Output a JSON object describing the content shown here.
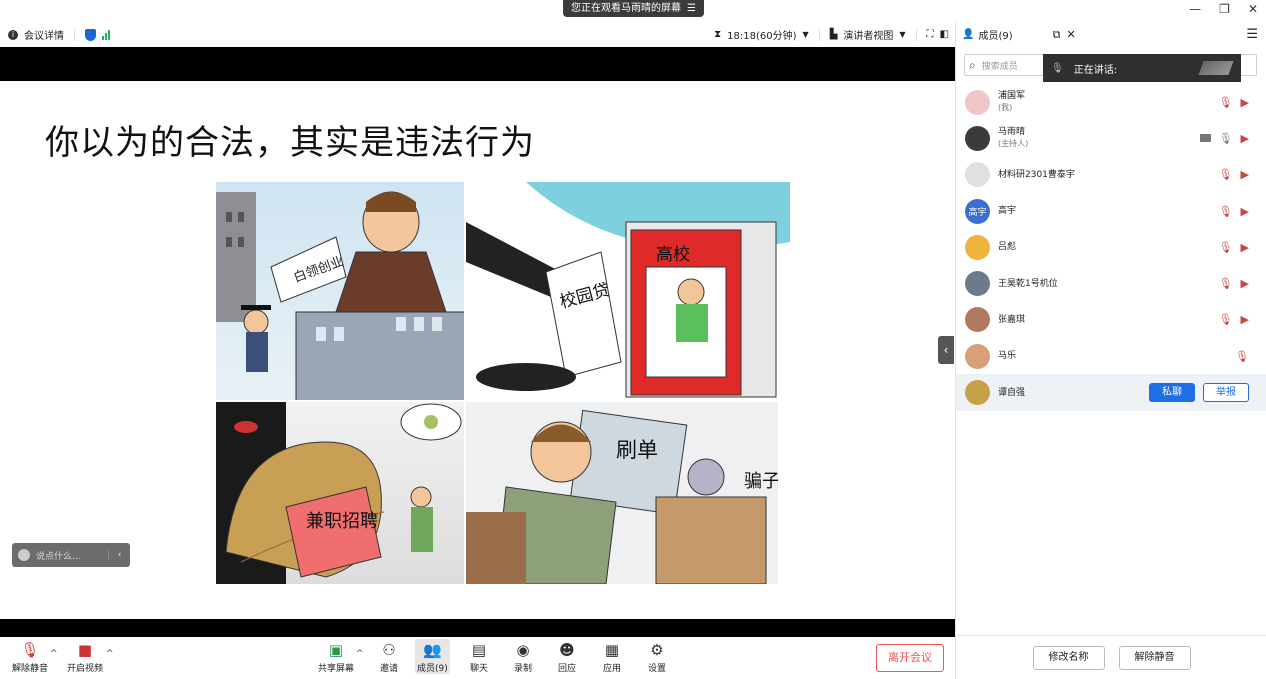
{
  "titlebar": {
    "banner": "您正在观看马雨晴的屏幕",
    "banner_icon": "menu-lines-icon",
    "min": "—",
    "restore": "❐",
    "close": "✕"
  },
  "infobar": {
    "meeting_details": "会议详情",
    "timer": "18:18(60分钟)",
    "view_mode": "演讲者视图"
  },
  "slide": {
    "title": "你以为的合法，其实是违法行为",
    "panel_texts": {
      "p1_sign": "白领创业",
      "p2_door": "高校",
      "p2_bag": "校园贷",
      "p3_label": "兼职招聘",
      "p4_screen": "刷单",
      "p4_side": "骗子"
    }
  },
  "chat": {
    "placeholder": "说点什么..."
  },
  "toolbar": {
    "unmute": "解除静音",
    "start_video": "开启视频",
    "share_screen": "共享屏幕",
    "invite": "邀请",
    "members": "成员(9)",
    "chat": "聊天",
    "record": "录制",
    "react": "回应",
    "apps": "应用",
    "settings": "设置",
    "leave": "离开会议"
  },
  "sidebar": {
    "title": "成员(9)",
    "search_placeholder": "搜索成员",
    "speaking_label": "正在讲话:",
    "members": [
      {
        "name": "浦国军",
        "sub": "(我)",
        "avatar_text": "",
        "avatar_color": "#f1c6c6"
      },
      {
        "name": "马雨晴",
        "sub": "(主持人)",
        "avatar_text": "",
        "avatar_color": "#3b3b3b"
      },
      {
        "name": "材料研2301曹泰宇",
        "sub": "",
        "avatar_text": "",
        "avatar_color": "#e0e0e0"
      },
      {
        "name": "高宇",
        "sub": "",
        "avatar_text": "高宇",
        "avatar_color": "#3a6fd0"
      },
      {
        "name": "吕彪",
        "sub": "",
        "avatar_text": "",
        "avatar_color": "#f0b43c"
      },
      {
        "name": "王昊乾1号机位",
        "sub": "",
        "avatar_text": "",
        "avatar_color": "#6b7b8c"
      },
      {
        "name": "张嘉琪",
        "sub": "",
        "avatar_text": "",
        "avatar_color": "#b07a60"
      },
      {
        "name": "马乐",
        "sub": "",
        "avatar_text": "",
        "avatar_color": "#d8a07a"
      },
      {
        "name": "谭自强",
        "sub": "",
        "avatar_text": "",
        "avatar_color": "#c8a048"
      }
    ],
    "private_chat": "私聊",
    "report": "举报",
    "rename": "修改名称",
    "unmute": "解除静音"
  }
}
